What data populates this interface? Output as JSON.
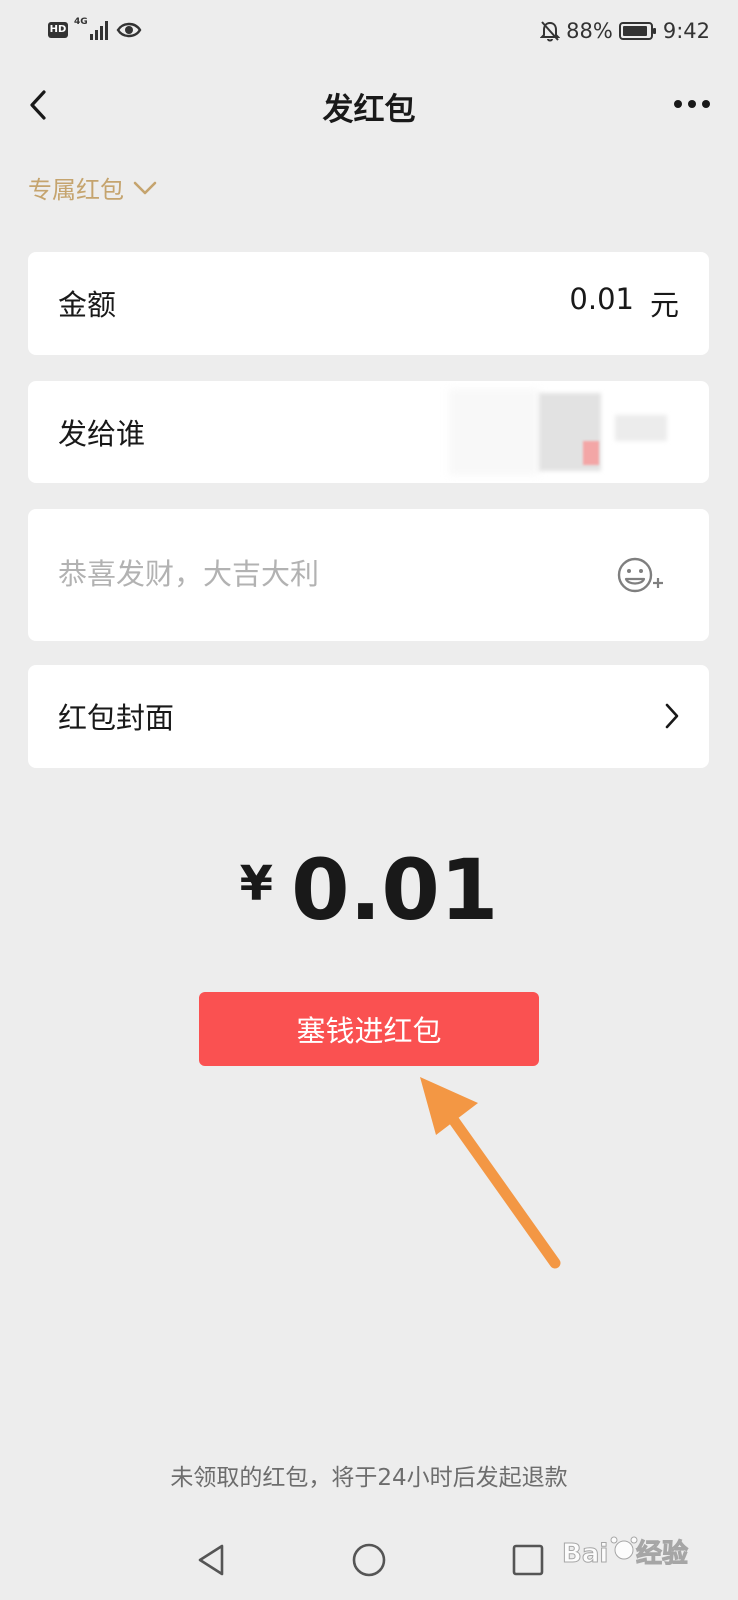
{
  "status_bar": {
    "hd_badge": "HD",
    "network": "4G",
    "battery_percent": "88%",
    "time": "9:42",
    "icons": [
      "hd-icon",
      "signal-icon",
      "eye-icon",
      "mute-bell-icon",
      "battery-icon"
    ]
  },
  "nav": {
    "title": "发红包",
    "back_icon": "chevron-left-icon",
    "more_icon": "more-dots-icon"
  },
  "type_selector": {
    "label": "专属红包",
    "icon": "chevron-down-icon"
  },
  "amount_row": {
    "label": "金额",
    "value": "0.01",
    "unit": "元"
  },
  "recipient_row": {
    "label": "发给谁"
  },
  "message": {
    "placeholder": "恭喜发财，大吉大利",
    "value": "",
    "icon": "emoji-add-icon"
  },
  "cover_row": {
    "label": "红包封面",
    "icon": "chevron-right-icon"
  },
  "total": {
    "currency": "¥",
    "amount": "0.01"
  },
  "submit_button": {
    "label": "塞钱进红包"
  },
  "footer_note": "未领取的红包，将于24小时后发起退款",
  "watermark": "Baidu经验",
  "colors": {
    "background": "#ededed",
    "card": "#ffffff",
    "accent_gold": "#c5a46e",
    "button_red": "#fa5151",
    "annotation_orange": "#f39744"
  }
}
